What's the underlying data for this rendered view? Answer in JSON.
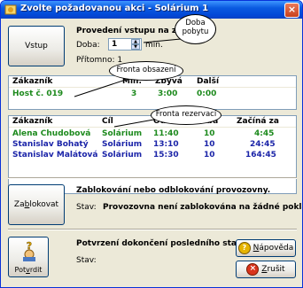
{
  "window": {
    "title": "Zvolte požadovanou akci - Solárium 1",
    "close": "×"
  },
  "entry": {
    "button": "Vstup",
    "heading": "Provedení vstupu na zvo",
    "duration_label": "Doba:",
    "duration_value": "1",
    "unit": "min.",
    "present_label": "Přítomno:",
    "present_value": "1"
  },
  "callouts": {
    "duration": "Doba pobytu",
    "queue": "Fronta obsazení",
    "reservations": "Fronta rezervací"
  },
  "occupancy": {
    "columns": [
      "Zákazník",
      "Min.",
      "Zbývá",
      "Další"
    ],
    "rows": [
      {
        "customer": "Host č. 019",
        "min": "3",
        "remaining": "3:00",
        "next": "0:00"
      }
    ]
  },
  "reservations": {
    "columns": [
      "Zákazník",
      "Cíl",
      "Od",
      "Doba",
      "Začíná za"
    ],
    "rows": [
      {
        "customer": "Alena Chudobová",
        "target": "Solárium",
        "from": "11:40",
        "duration": "10",
        "starts_in": "4:45",
        "color": "#1d8a1d"
      },
      {
        "customer": "Stanislav Bohatý",
        "target": "Solárium",
        "from": "13:10",
        "duration": "10",
        "starts_in": "24:45",
        "color": "#1b24a8"
      },
      {
        "customer": "Stanislav Malátová",
        "target": "Solárium",
        "from": "15:30",
        "duration": "10",
        "starts_in": "164:45",
        "color": "#1b24a8"
      }
    ]
  },
  "block": {
    "button_pre": "Za",
    "button_u": "b",
    "button_post": "lokovat",
    "heading": "Zablokování nebo odblokování provozovny.",
    "status_label": "Stav:",
    "status_value": "Provozovna není zablokována na žádné pokladně."
  },
  "confirm": {
    "button_pre": "Pot",
    "button_u": "v",
    "button_post": "rdit",
    "heading": "Potvrzení dokončení posledního stavu.",
    "status_label": "Stav:"
  },
  "help_button": {
    "pre": "",
    "u": "N",
    "post": "ápověda"
  },
  "cancel_button": {
    "pre": "",
    "u": "Z",
    "post": "rušit"
  },
  "colors": {
    "green": "#1d8a1d",
    "blue": "#1b24a8",
    "title_bar": "#0a5ae0"
  }
}
